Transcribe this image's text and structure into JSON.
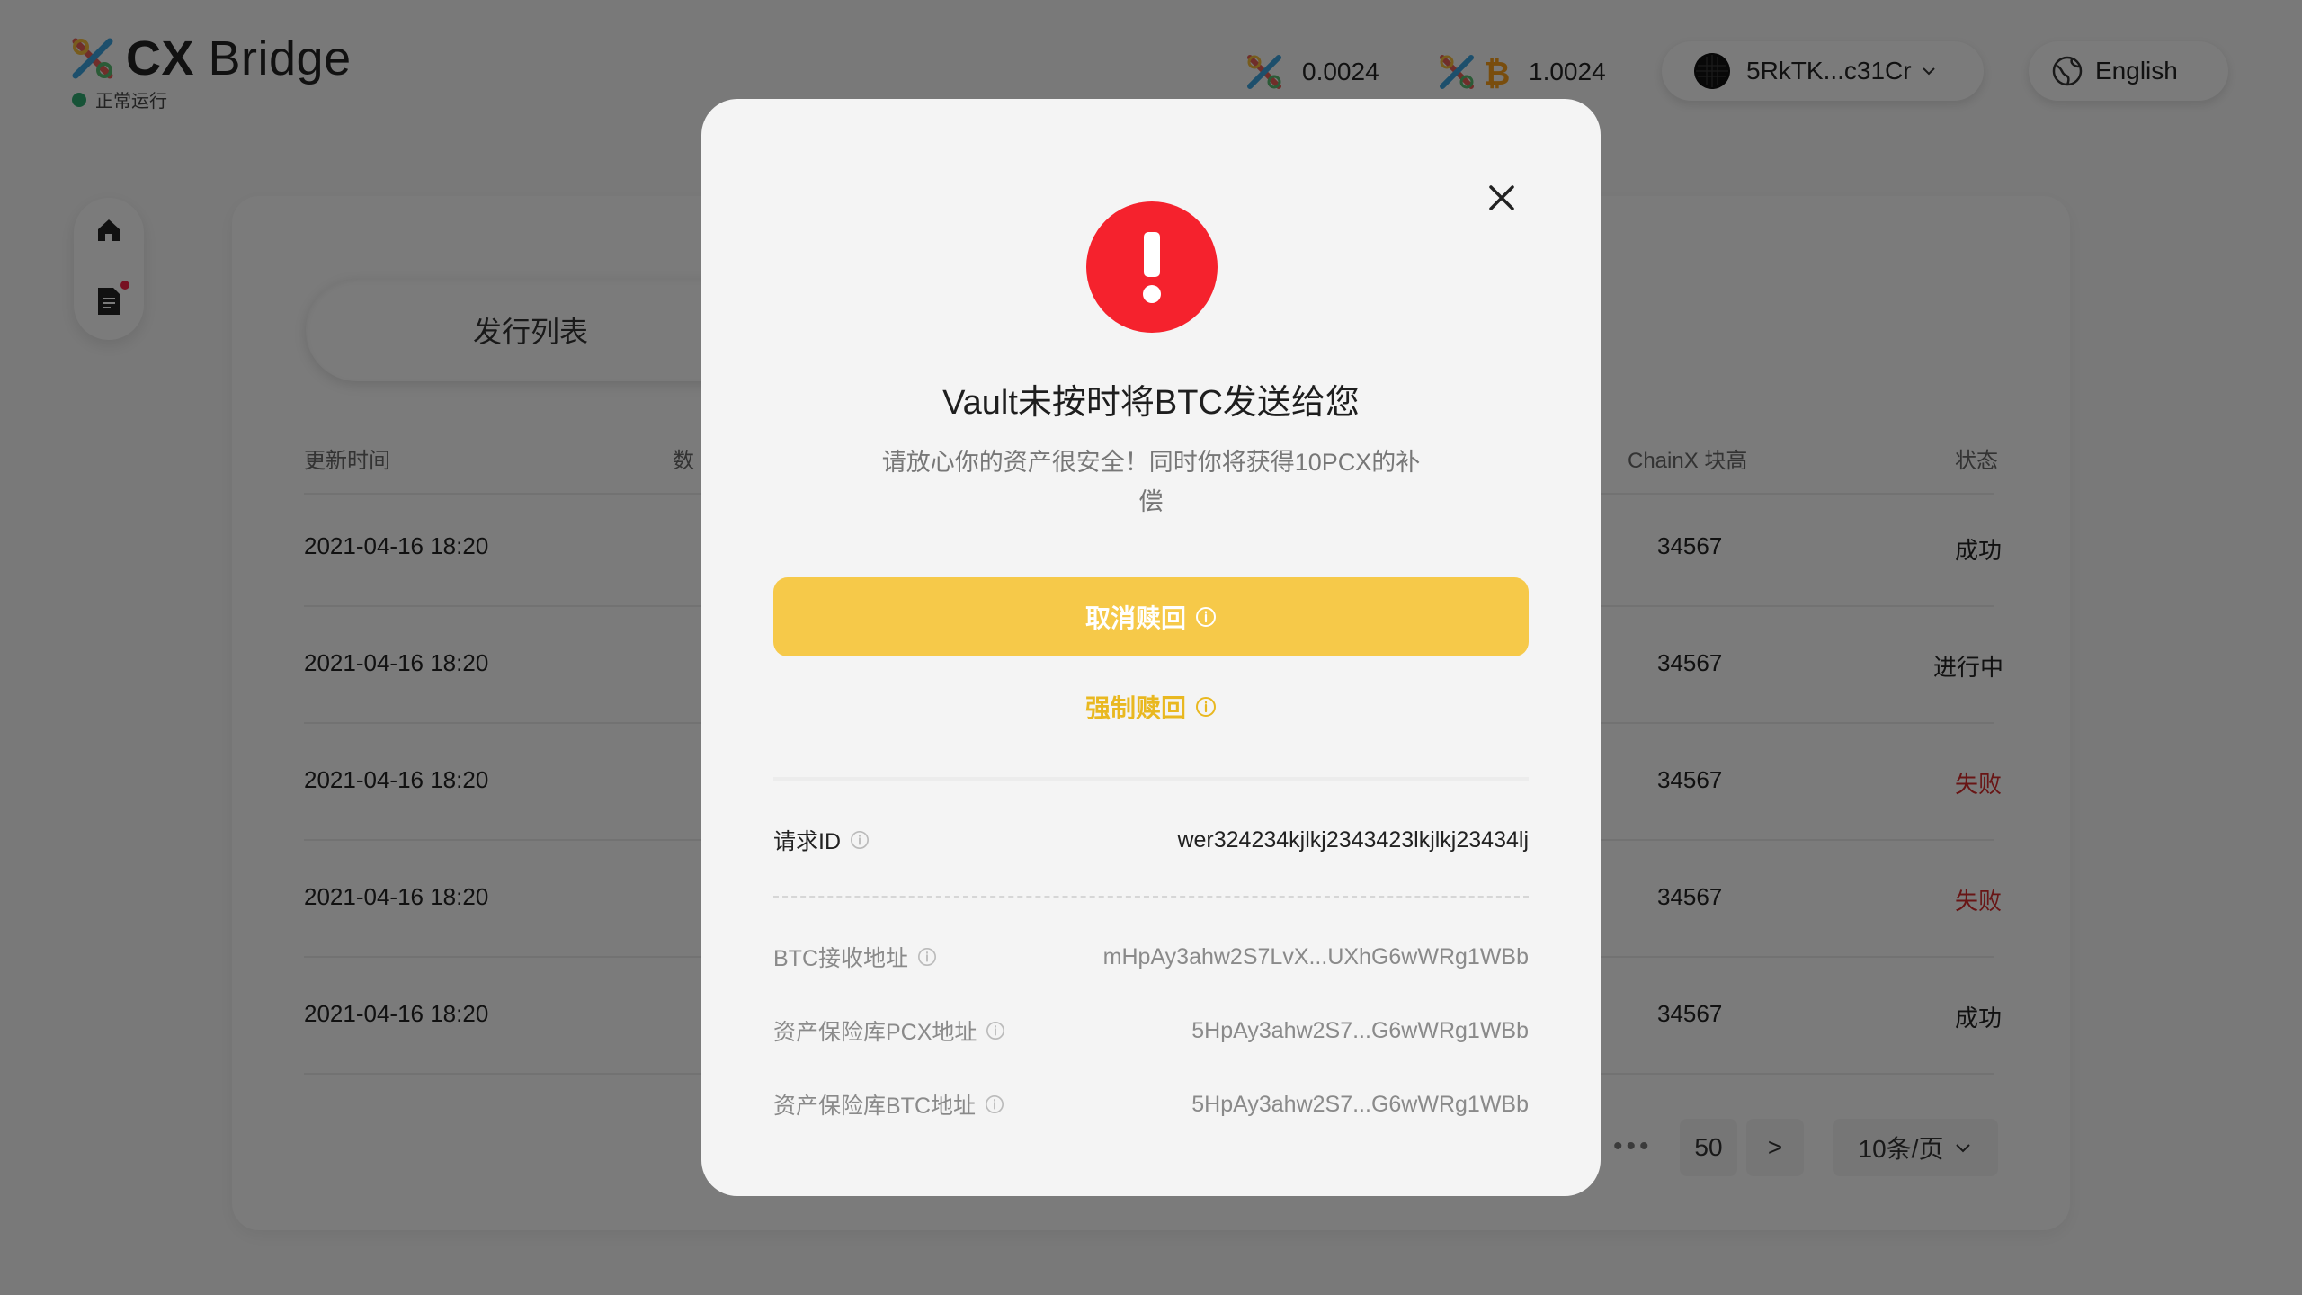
{
  "header": {
    "app_name_bold": "CX",
    "app_name_rest": "Bridge",
    "status_text": "正常运行",
    "balances": [
      {
        "icon": "chainx-icon",
        "value": "0.0024"
      },
      {
        "icon": "xbtc-icon",
        "value": "1.0024"
      }
    ],
    "account": "5RkTK...c31Cr",
    "language": "English"
  },
  "sidenav": {
    "items": [
      "home-icon",
      "document-icon"
    ]
  },
  "main": {
    "tab_active": "发行列表",
    "columns": {
      "update_time": "更新时间",
      "amount_partial": "数",
      "chainx_height": "ChainX 块高",
      "status": "状态"
    },
    "rows": [
      {
        "time": "2021-04-16 18:20",
        "height": "34567",
        "status": "成功",
        "failed": false
      },
      {
        "time": "2021-04-16 18:20",
        "height": "34567",
        "status": "进行中",
        "failed": false
      },
      {
        "time": "2021-04-16 18:20",
        "height": "34567",
        "status": "失败",
        "failed": true
      },
      {
        "time": "2021-04-16 18:20",
        "height": "34567",
        "status": "失败",
        "failed": true
      },
      {
        "time": "2021-04-16 18:20",
        "height": "34567",
        "status": "成功",
        "failed": false
      }
    ],
    "pagination": {
      "ellipsis": "•••",
      "last_page": "50",
      "next": ">",
      "page_size": "10条/页"
    }
  },
  "modal": {
    "title": "Vault未按时将BTC发送给您",
    "subtitle": "请放心你的资产很安全！同时你将获得10PCX的补偿",
    "cancel_label": "取消赎回",
    "force_label": "强制赎回",
    "request_id_label": "请求ID",
    "request_id_value": "wer324234kjlkj2343423lkjlkj23434lj",
    "btc_addr_label": "BTC接收地址",
    "btc_addr_value": "mHpAy3ahw2S7LvX...UXhG6wWRg1WBb",
    "vault_pcx_label": "资产保险库PCX地址",
    "vault_pcx_value": "5HpAy3ahw2S7...G6wWRg1WBb",
    "vault_btc_label": "资产保险库BTC地址",
    "vault_btc_value": "5HpAy3ahw2S7...G6wWRg1WBb",
    "colors": {
      "alert": "#f5222d",
      "primary": "#f6c949",
      "secondary_text": "#e9b820"
    }
  }
}
